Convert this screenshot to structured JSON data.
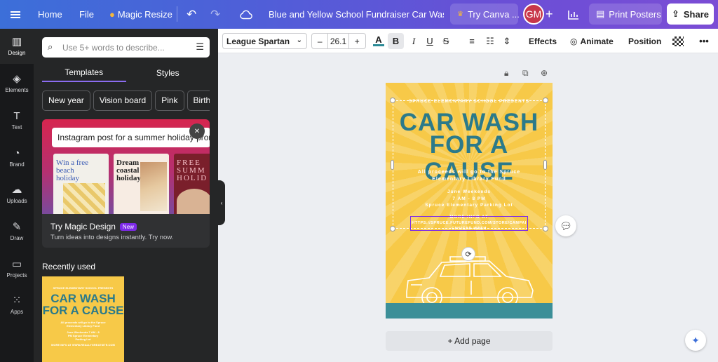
{
  "topbar": {
    "home": "Home",
    "file": "File",
    "magic_resize": "Magic Resize",
    "doc_title": "Blue and Yellow School Fundraiser Car Wash P...",
    "try_canva": "Try Canva ...",
    "avatar_initials": "GM",
    "print_posters": "Print Posters",
    "share": "Share"
  },
  "rail": [
    {
      "label": "Design",
      "icon": "layout-icon"
    },
    {
      "label": "Elements",
      "icon": "shapes-icon"
    },
    {
      "label": "Text",
      "icon": "text-icon"
    },
    {
      "label": "Brand",
      "icon": "brand-icon"
    },
    {
      "label": "Uploads",
      "icon": "cloud-upload-icon"
    },
    {
      "label": "Draw",
      "icon": "pen-icon"
    },
    {
      "label": "Projects",
      "icon": "folder-icon"
    },
    {
      "label": "Apps",
      "icon": "grid-icon"
    }
  ],
  "panel": {
    "search_placeholder": "Use 5+ words to describe...",
    "tabs": [
      "Templates",
      "Styles"
    ],
    "chips": [
      "New year",
      "Vision board",
      "Pink",
      "Birth"
    ],
    "promo_input": "Instagram post for a summer holiday promo",
    "promo_cards": [
      {
        "text": "Win a free beach holiday"
      },
      {
        "text": "Dream coastal holiday"
      },
      {
        "text": "FREE SUMM HOLID"
      }
    ],
    "promo_title": "Try Magic Design",
    "promo_badge": "New",
    "promo_sub": "Turn ideas into designs instantly. Try now.",
    "recent_heading": "Recently used",
    "recent_thumb": {
      "line1": "SPRUCE ELEMENTARY SCHOOL PRESENTS",
      "line2": "CAR WASH",
      "line3": "FOR A CAUSE",
      "line4": "All proceeds will go to the Spruce Elementary Library Fund",
      "line5": "June Weekends 7 AM - 8 PM Spruce Elementary Parking Lot",
      "line6": "MORE INFO AT WWW.REALLYGREATSITE.COM"
    }
  },
  "toolbar": {
    "font": "League Spartan",
    "size": "26.1",
    "minus": "–",
    "plus": "+",
    "effects": "Effects",
    "animate": "Animate",
    "position": "Position"
  },
  "poster": {
    "presents": "SPRUCE ELEMENTARY SCHOOL PRESENTS",
    "headline1": "CAR WASH",
    "headline2": "FOR A CAUSE",
    "proceeds": "All proceeds will go to the Spruce Elementary Library Fund",
    "when1": "June Weekends",
    "when2": "7 AM - 8 PM",
    "where": "Spruce Elementary Parking Lot",
    "more_info": "MORE INFO AT",
    "url": "HTTPS://SPRUCE.FUTUREFUND.COM/STORE/CAMPAIGNS/CAR-WASH"
  },
  "add_page": "+ Add page",
  "colors": {
    "poster_bg": "#f7c948",
    "headline": "#2b7a8a",
    "ground": "#3c8f98",
    "accent": "#7d2ae8"
  }
}
